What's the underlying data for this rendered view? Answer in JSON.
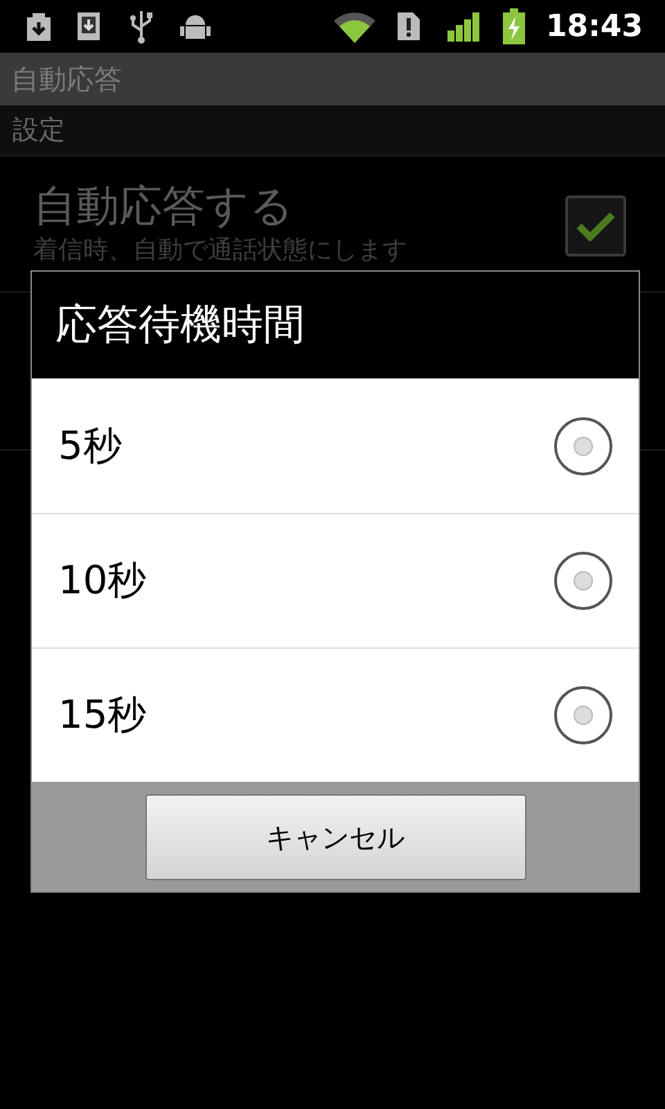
{
  "status_bar": {
    "time": "18:43"
  },
  "app_bar": {
    "title": "自動応答"
  },
  "category": {
    "title": "設定"
  },
  "preference": {
    "title": "自動応答する",
    "summary": "着信時、自動で通話状態にします",
    "checked": true
  },
  "dialog": {
    "title": "応答待機時間",
    "options": [
      {
        "label": "5秒",
        "selected": false
      },
      {
        "label": "10秒",
        "selected": false
      },
      {
        "label": "15秒",
        "selected": false
      }
    ],
    "buttons": [
      "キャンセル"
    ]
  }
}
